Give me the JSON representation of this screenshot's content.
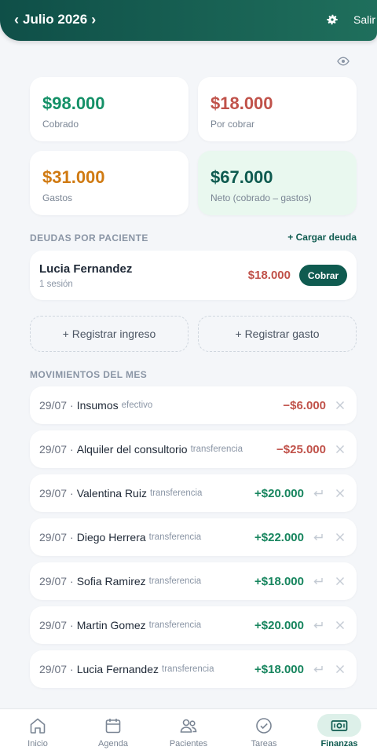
{
  "header": {
    "prev": "‹",
    "title": "Julio 2026",
    "next": "›",
    "logout": "Salir"
  },
  "stats": {
    "cobrado": {
      "amount": "$98.000",
      "label": "Cobrado",
      "color": "#149067"
    },
    "por_cobrar": {
      "amount": "$18.000",
      "label": "Por cobrar",
      "color": "#c0524a"
    },
    "gastos": {
      "amount": "$31.000",
      "label": "Gastos",
      "color": "#d07a12"
    },
    "neto": {
      "amount": "$67.000",
      "label": "Neto (cobrado – gastos)",
      "color": "#0f5b50"
    }
  },
  "debts": {
    "title": "DEUDAS POR PACIENTE",
    "add_label": "+ Cargar deuda",
    "items": [
      {
        "name": "Lucia Fernandez",
        "sessions": "1 sesión",
        "amount": "$18.000",
        "action": "Cobrar"
      }
    ]
  },
  "actions": {
    "income": "+ Registrar ingreso",
    "expense": "+ Registrar gasto"
  },
  "movements": {
    "title": "MOVIMIENTOS DEL MES",
    "items": [
      {
        "date": "29/07",
        "sep": "·",
        "desc": "Insumos",
        "method": "efectivo",
        "amount": "−$6.000"
      },
      {
        "date": "29/07",
        "sep": "·",
        "desc": "Alquiler del consultorio",
        "method": "transferencia",
        "amount": "−$25.000"
      },
      {
        "date": "29/07",
        "sep": "·",
        "desc": "Valentina Ruiz",
        "method": "transferencia",
        "amount": "+$20.000"
      },
      {
        "date": "29/07",
        "sep": "·",
        "desc": "Diego Herrera",
        "method": "transferencia",
        "amount": "+$22.000"
      },
      {
        "date": "29/07",
        "sep": "·",
        "desc": "Sofia Ramirez",
        "method": "transferencia",
        "amount": "+$18.000"
      },
      {
        "date": "29/07",
        "sep": "·",
        "desc": "Martin Gomez",
        "method": "transferencia",
        "amount": "+$20.000"
      },
      {
        "date": "29/07",
        "sep": "·",
        "desc": "Lucia Fernandez",
        "method": "transferencia",
        "amount": "+$18.000"
      }
    ]
  },
  "nav": {
    "items": [
      {
        "label": "Inicio",
        "icon": "home-icon"
      },
      {
        "label": "Agenda",
        "icon": "calendar-icon"
      },
      {
        "label": "Pacientes",
        "icon": "users-icon"
      },
      {
        "label": "Tareas",
        "icon": "check-circle-icon"
      },
      {
        "label": "Finanzas",
        "icon": "cash-icon",
        "active": true
      }
    ]
  },
  "colors": {
    "brand": "#0f5b50",
    "income": "#17855e",
    "expense": "#c0524a",
    "active_tab_bg": "#ddf0e9"
  }
}
